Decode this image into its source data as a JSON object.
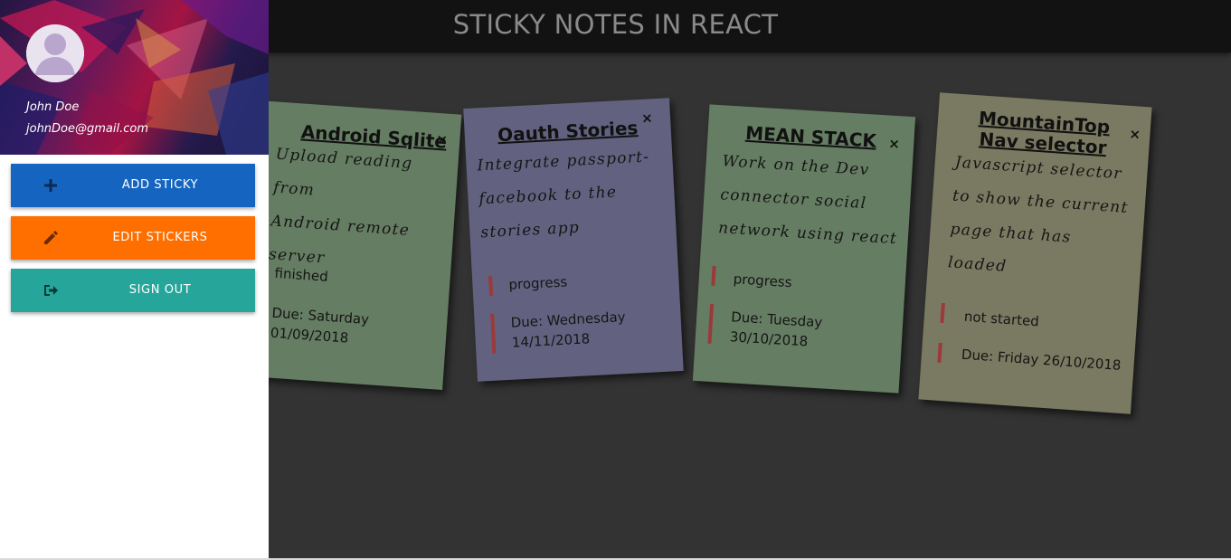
{
  "header": {
    "title": "STICKY NOTES IN REACT"
  },
  "sidebar": {
    "user": {
      "name": "John Doe",
      "email": "johnDoe@gmail.com"
    },
    "buttons": [
      {
        "label": "ADD STICKY",
        "icon": "plus-icon",
        "color": "#1565c0"
      },
      {
        "label": "EDIT STICKERS",
        "icon": "pencil-icon",
        "color": "#ff6f00"
      },
      {
        "label": "SIGN OUT",
        "icon": "sign-out-icon",
        "color": "#26a69a"
      }
    ]
  },
  "notes": [
    {
      "title": "Android Sqlite",
      "body": [
        "Upload reading from",
        "Android remote",
        "server"
      ],
      "status": "finished",
      "due": [
        "Due: Saturday",
        "01/09/2018"
      ],
      "color": "#657d62"
    },
    {
      "title": "Oauth Stories",
      "body": [
        "Integrate passport-",
        "facebook to the",
        "stories app"
      ],
      "status": "progress",
      "due": [
        "Due: Wednesday",
        "14/11/2018"
      ],
      "color": "#626280"
    },
    {
      "title": "MEAN STACK",
      "body": [
        "Work on the Dev",
        "connector social",
        "network using react"
      ],
      "status": "progress",
      "due": [
        "Due: Tuesday",
        "30/10/2018"
      ],
      "color": "#657d62"
    },
    {
      "title": "MountainTop Nav selector",
      "title_lines": [
        "MountainTop",
        "Nav selector"
      ],
      "body": [
        "Javascript selector",
        "to show the current",
        "page that has",
        "loaded"
      ],
      "status": "not started",
      "due": [
        "Due: Friday 26/10/2018"
      ],
      "color": "#7a7a62"
    }
  ],
  "close_symbol": "×"
}
